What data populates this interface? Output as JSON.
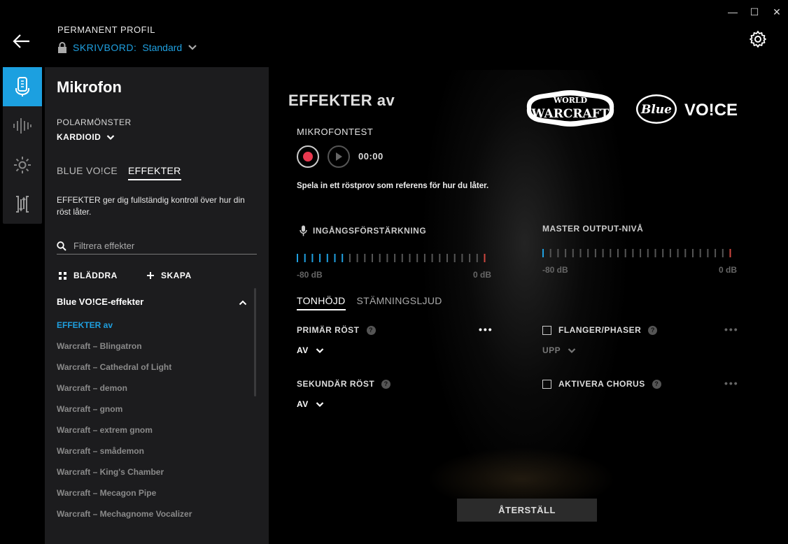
{
  "window": {
    "min": "—",
    "max": "☐",
    "close": "✕"
  },
  "header": {
    "profile_label": "PERMANENT PROFIL",
    "profile_device": "SKRIVBORD:",
    "profile_name": "Standard"
  },
  "sidebar": {
    "title": "Mikrofon",
    "polar_label": "POLARMÖNSTER",
    "polar_value": "KARDIOID",
    "tabs": [
      {
        "label": "BLUE VO!CE"
      },
      {
        "label": "EFFEKTER"
      }
    ],
    "description": "EFFEKTER ger dig fullständig kontroll över hur din röst låter.",
    "filter_placeholder": "Filtrera effekter",
    "browse_label": "BLÄDDRA",
    "create_label": "SKAPA",
    "group_title": "Blue VO!CE-effekter",
    "effects": [
      "EFFEKTER av",
      "Warcraft – Blingatron",
      "Warcraft – Cathedral of Light",
      "Warcraft – demon",
      "Warcraft – gnom",
      "Warcraft – extrem gnom",
      "Warcraft – smådemon",
      "Warcraft – King's Chamber",
      "Warcraft – Mecagon Pipe",
      "Warcraft – Mechagnome Vocalizer"
    ]
  },
  "main": {
    "title": "EFFEKTER av",
    "logos": {
      "wow_top": "WORLD",
      "wow_main": "WARCRAFT",
      "blue": "Blue",
      "voice": "VO!CE"
    },
    "mic_test_label": "MIKROFONTEST",
    "timer": "00:00",
    "hint": "Spela in ett röstprov som referens för hur du låter.",
    "input_gain": {
      "label": "INGÅNGSFÖRSTÄRKNING",
      "min": "-80 dB",
      "max": "0 dB",
      "level": 0.27
    },
    "master_output": {
      "label": "MASTER OUTPUT-NIVÅ",
      "min": "-80 dB",
      "max": "0 dB",
      "level": 0.04
    },
    "tabs": [
      {
        "label": "TONHÖJD"
      },
      {
        "label": "STÄMNINGSLJUD"
      }
    ],
    "primary_voice": {
      "label": "PRIMÄR RÖST",
      "value": "AV"
    },
    "secondary_voice": {
      "label": "SEKUNDÄR RÖST",
      "value": "AV"
    },
    "flanger": {
      "label": "FLANGER/PHASER",
      "value": "UPP"
    },
    "chorus": {
      "label": "AKTIVERA CHORUS"
    },
    "help_glyph": "?",
    "dots": "•••",
    "reset_label": "ÅTERSTÄLL"
  },
  "colors": {
    "accent": "#1fa0e0",
    "record": "#e8384f",
    "meter_end": "#d0473f",
    "meter_off": "#555555"
  }
}
